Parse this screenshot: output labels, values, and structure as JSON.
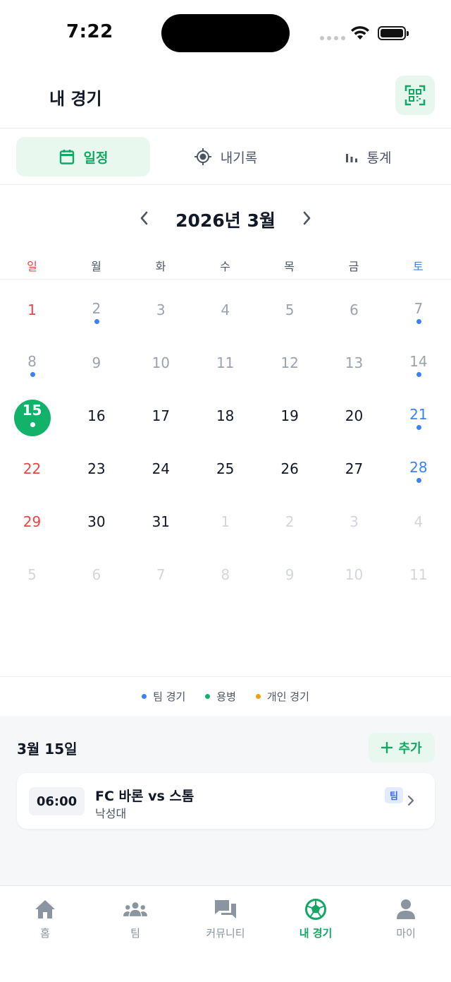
{
  "status_bar": {
    "time": "7:22"
  },
  "header": {
    "title": "내 경기",
    "qr_icon": "qr-scan-icon"
  },
  "tabs": [
    {
      "label": "일정",
      "icon": "calendar-icon",
      "active": true
    },
    {
      "label": "내기록",
      "icon": "target-icon",
      "active": false
    },
    {
      "label": "통계",
      "icon": "bar-chart-icon",
      "active": false
    }
  ],
  "calendar": {
    "month_label": "2026년 3월",
    "weekdays": [
      "일",
      "월",
      "화",
      "수",
      "목",
      "금",
      "토"
    ],
    "weeks": [
      [
        {
          "d": "1",
          "s": "sun"
        },
        {
          "d": "2",
          "s": "muted",
          "dot": "#3b82f6"
        },
        {
          "d": "3",
          "s": "muted"
        },
        {
          "d": "4",
          "s": "muted"
        },
        {
          "d": "5",
          "s": "muted"
        },
        {
          "d": "6",
          "s": "muted"
        },
        {
          "d": "7",
          "s": "muted",
          "dot": "#3b82f6"
        }
      ],
      [
        {
          "d": "8",
          "s": "muted",
          "dot": "#3b82f6"
        },
        {
          "d": "9",
          "s": "muted"
        },
        {
          "d": "10",
          "s": "muted"
        },
        {
          "d": "11",
          "s": "muted"
        },
        {
          "d": "12",
          "s": "muted"
        },
        {
          "d": "13",
          "s": "muted"
        },
        {
          "d": "14",
          "s": "muted",
          "dot": "#3b82f6"
        }
      ],
      [
        {
          "d": "15",
          "s": "selected",
          "dot": "#ffffff"
        },
        {
          "d": "16",
          "s": "strong"
        },
        {
          "d": "17",
          "s": "strong"
        },
        {
          "d": "18",
          "s": "strong"
        },
        {
          "d": "19",
          "s": "strong"
        },
        {
          "d": "20",
          "s": "strong"
        },
        {
          "d": "21",
          "s": "sat",
          "dot": "#3b82f6"
        }
      ],
      [
        {
          "d": "22",
          "s": "sun"
        },
        {
          "d": "23",
          "s": "strong"
        },
        {
          "d": "24",
          "s": "strong"
        },
        {
          "d": "25",
          "s": "strong"
        },
        {
          "d": "26",
          "s": "strong"
        },
        {
          "d": "27",
          "s": "strong"
        },
        {
          "d": "28",
          "s": "sat",
          "dot": "#3b82f6"
        }
      ],
      [
        {
          "d": "29",
          "s": "sun"
        },
        {
          "d": "30",
          "s": "strong"
        },
        {
          "d": "31",
          "s": "strong"
        },
        {
          "d": "1",
          "s": "faded"
        },
        {
          "d": "2",
          "s": "faded"
        },
        {
          "d": "3",
          "s": "faded"
        },
        {
          "d": "4",
          "s": "faded"
        }
      ],
      [
        {
          "d": "5",
          "s": "faded"
        },
        {
          "d": "6",
          "s": "faded"
        },
        {
          "d": "7",
          "s": "faded"
        },
        {
          "d": "8",
          "s": "faded"
        },
        {
          "d": "9",
          "s": "faded"
        },
        {
          "d": "10",
          "s": "faded"
        },
        {
          "d": "11",
          "s": "faded"
        }
      ]
    ]
  },
  "legend": [
    {
      "label": "팀 경기",
      "color": "#3b82f6"
    },
    {
      "label": "용병",
      "color": "#12b26b"
    },
    {
      "label": "개인 경기",
      "color": "#f59e0b"
    }
  ],
  "day_panel": {
    "title": "3월 15일",
    "add_label": "추가",
    "matches": [
      {
        "time": "06:00",
        "title": "FC 바론 vs 스톰",
        "venue": "낙성대",
        "badge": "팀"
      }
    ]
  },
  "bottom_nav": [
    {
      "label": "홈",
      "icon": "home-icon",
      "active": false
    },
    {
      "label": "팀",
      "icon": "team-icon",
      "active": false
    },
    {
      "label": "커뮤니티",
      "icon": "chat-icon",
      "active": false
    },
    {
      "label": "내 경기",
      "icon": "soccer-ball-icon",
      "active": true
    },
    {
      "label": "마이",
      "icon": "person-icon",
      "active": false
    }
  ],
  "colors": {
    "accent": "#12b26b",
    "accent_text": "#12a863",
    "sunday": "#ef4444",
    "saturday": "#3b82f6"
  }
}
